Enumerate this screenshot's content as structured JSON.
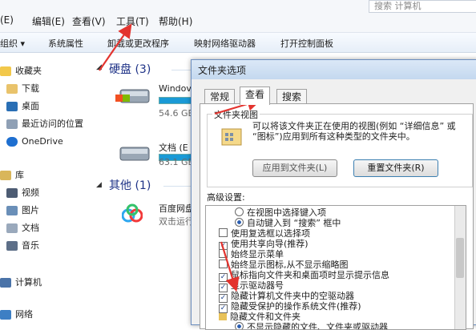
{
  "search_placeholder": "搜索 计算机",
  "menu": [
    "(E)",
    "编辑(E)",
    "查看(V)",
    "工具(T)",
    "帮助(H)"
  ],
  "toolbar": [
    "组织 ▾",
    "系统属性",
    "卸载或更改程序",
    "映射网络驱动器",
    "打开控制面板"
  ],
  "nav": {
    "favorites": "收藏夹",
    "downloads": "下载",
    "desktop": "桌面",
    "recent": "最近访问的位置",
    "onedrive": "OneDrive",
    "library": "库",
    "video": "视频",
    "pictures": "图片",
    "docs": "文档",
    "music": "音乐",
    "computer": "计算机",
    "network": "网络"
  },
  "content": {
    "hdd_header": "硬盘 (3)",
    "drive1_name": "Windov",
    "drive1_size": "54.6 GB",
    "drive1_fill": 0.3,
    "drive2_name": "文档 (E",
    "drive2_size": "63.1 GB",
    "drive2_fill": 0.2,
    "other_header": "其他 (1)",
    "other_name": "百度网盘",
    "other_desc": "双击运行"
  },
  "dialog": {
    "title": "文件夹选项",
    "tabs": [
      "常规",
      "查看",
      "搜索"
    ],
    "folder_view_label": "文件夹视图",
    "folder_view_desc": "可以将该文件夹正在使用的视图(例如 “详细信息” 或 “图标”)应用到所有这种类型的文件夹中。",
    "apply_button": "应用到文件夹(L)",
    "reset_button": "重置文件夹(R)",
    "advanced_label": "高级设置:",
    "options": [
      {
        "type": "radio",
        "label": "在视图中选择键入项",
        "checked": false
      },
      {
        "type": "radio",
        "label": "自动键入到 “搜索” 框中",
        "checked": true
      },
      {
        "type": "check",
        "label": "使用复选框以选择项",
        "checked": false
      },
      {
        "type": "check",
        "label": "使用共享向导(推荐)",
        "checked": true
      },
      {
        "type": "check",
        "label": "始终显示菜单",
        "checked": false
      },
      {
        "type": "check",
        "label": "始终显示图标,从不显示缩略图",
        "checked": false
      },
      {
        "type": "check",
        "label": "鼠标指向文件夹和桌面项时显示提示信息",
        "checked": true
      },
      {
        "type": "check",
        "label": "显示驱动器号",
        "checked": true
      },
      {
        "type": "check",
        "label": "隐藏计算机文件夹中的空驱动器",
        "checked": true
      },
      {
        "type": "check",
        "label": "隐藏受保护的操作系统文件(推荐)",
        "checked": true
      },
      {
        "type": "folder",
        "label": "隐藏文件和文件夹",
        "checked": false
      },
      {
        "type": "radio",
        "label": "不显示隐藏的文件、文件夹或驱动器",
        "checked": true
      }
    ]
  }
}
